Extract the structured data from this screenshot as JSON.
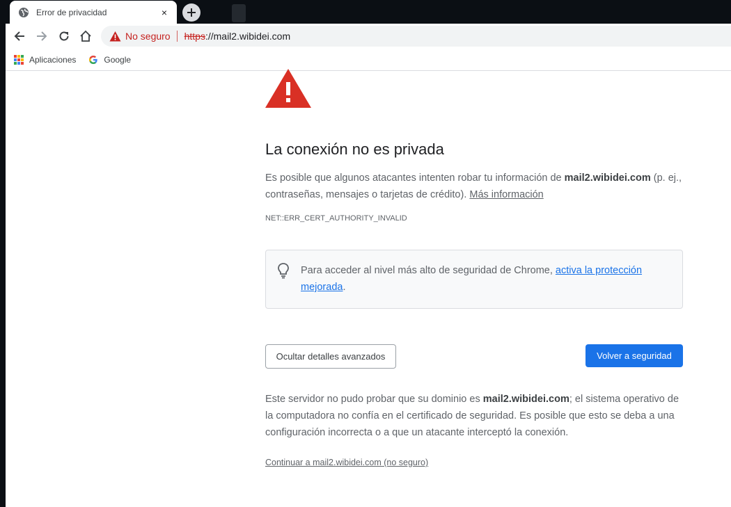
{
  "tab": {
    "title": "Error de privacidad",
    "close_glyph": "×"
  },
  "newtab": {
    "glyph": "+"
  },
  "omnibox": {
    "security_label": "No seguro",
    "url_scheme": "https",
    "url_rest": "://mail2.wibidei.com"
  },
  "bookmarks": [
    {
      "label": "Aplicaciones",
      "icon": "apps-grid-icon"
    },
    {
      "label": "Google",
      "icon": "google-g-icon"
    }
  ],
  "page": {
    "heading": "La conexión no es privada",
    "intro_before": "Es posible que algunos atacantes intenten robar tu información de ",
    "intro_domain": "mail2.wibidei.com",
    "intro_after": " (p. ej., contraseñas, mensajes o tarjetas de crédito). ",
    "more_info_link": "Más información",
    "error_code": "NET::ERR_CERT_AUTHORITY_INVALID",
    "hint_before": "Para acceder al nivel más alto de seguridad de Chrome, ",
    "hint_link": "activa la protección mejorada",
    "hint_after": ".",
    "hide_details_button": "Ocultar detalles avanzados",
    "back_to_safety_button": "Volver a seguridad",
    "details_before": "Este servidor no pudo probar que su dominio es ",
    "details_domain": "mail2.wibidei.com",
    "details_after": "; el sistema operativo de la computadora no confía en el certificado de seguridad. Es posible que esto se deba a una configuración incorrecta o a que un atacante interceptó la conexión.",
    "proceed_link": "Continuar a mail2.wibidei.com (no seguro)"
  },
  "colors": {
    "warning_red": "#d93025",
    "link_blue": "#1a73e8",
    "primary_button": "#1a73e8",
    "tabstrip_bg": "#0b0f14"
  }
}
